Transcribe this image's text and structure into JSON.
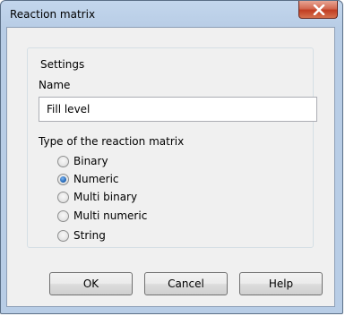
{
  "window": {
    "title": "Reaction matrix"
  },
  "settings": {
    "group_label": "Settings",
    "name_label": "Name",
    "name_value": "Fill level",
    "type_label": "Type of the reaction matrix",
    "options": [
      {
        "label": "Binary",
        "checked": false
      },
      {
        "label": "Numeric",
        "checked": true
      },
      {
        "label": "Multi binary",
        "checked": false
      },
      {
        "label": "Multi numeric",
        "checked": false
      },
      {
        "label": "String",
        "checked": false
      }
    ]
  },
  "buttons": {
    "ok": "OK",
    "cancel": "Cancel",
    "help": "Help"
  },
  "icons": {
    "close": "close-icon"
  }
}
